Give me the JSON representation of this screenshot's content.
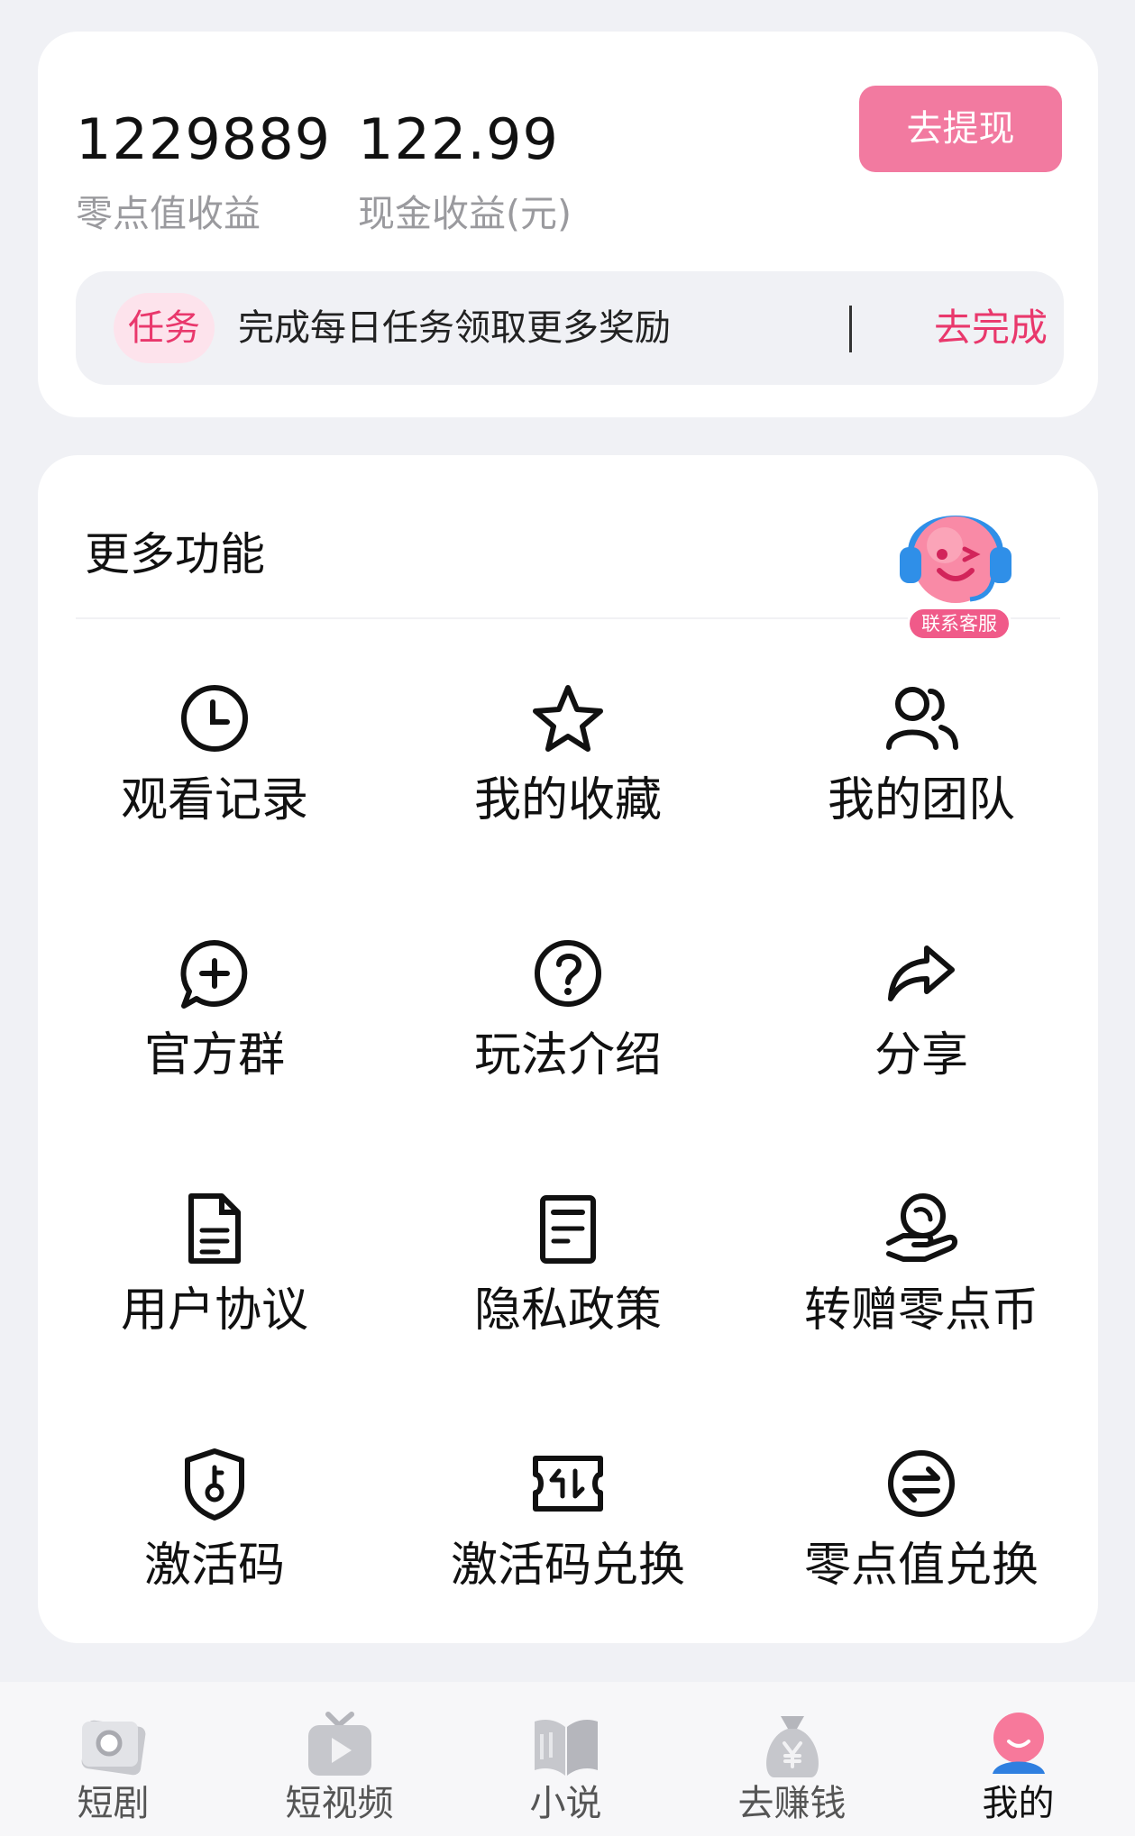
{
  "earnings": {
    "points_value": "1229889",
    "points_label": "零点值收益",
    "cash_value": "122.99",
    "cash_label": "现金收益(元)",
    "withdraw_button": "去提现"
  },
  "task": {
    "badge": "任务",
    "text": "完成每日任务领取更多奖励",
    "action": "去完成"
  },
  "functions": {
    "title": "更多功能",
    "customer_service_label": "联系客服",
    "items": [
      {
        "label": "观看记录",
        "icon": "clock-icon"
      },
      {
        "label": "我的收藏",
        "icon": "star-icon"
      },
      {
        "label": "我的团队",
        "icon": "team-icon"
      },
      {
        "label": "官方群",
        "icon": "chat-plus-icon"
      },
      {
        "label": "玩法介绍",
        "icon": "help-icon"
      },
      {
        "label": "分享",
        "icon": "share-icon"
      },
      {
        "label": "用户协议",
        "icon": "document-icon"
      },
      {
        "label": "隐私政策",
        "icon": "policy-icon"
      },
      {
        "label": "转赠零点币",
        "icon": "gift-hand-icon"
      },
      {
        "label": "激活码",
        "icon": "key-shield-icon"
      },
      {
        "label": "激活码兑换",
        "icon": "ticket-exchange-icon"
      },
      {
        "label": "零点值兑换",
        "icon": "exchange-icon"
      }
    ]
  },
  "tabbar": {
    "items": [
      {
        "label": "短剧",
        "icon": "drama-icon"
      },
      {
        "label": "短视频",
        "icon": "video-icon"
      },
      {
        "label": "小说",
        "icon": "book-icon"
      },
      {
        "label": "去赚钱",
        "icon": "money-bag-icon"
      },
      {
        "label": "我的",
        "icon": "profile-icon"
      }
    ],
    "active_index": 4
  },
  "colors": {
    "accent": "#f27aa0",
    "task_red": "#e9386c",
    "background": "#f0f1f5"
  }
}
